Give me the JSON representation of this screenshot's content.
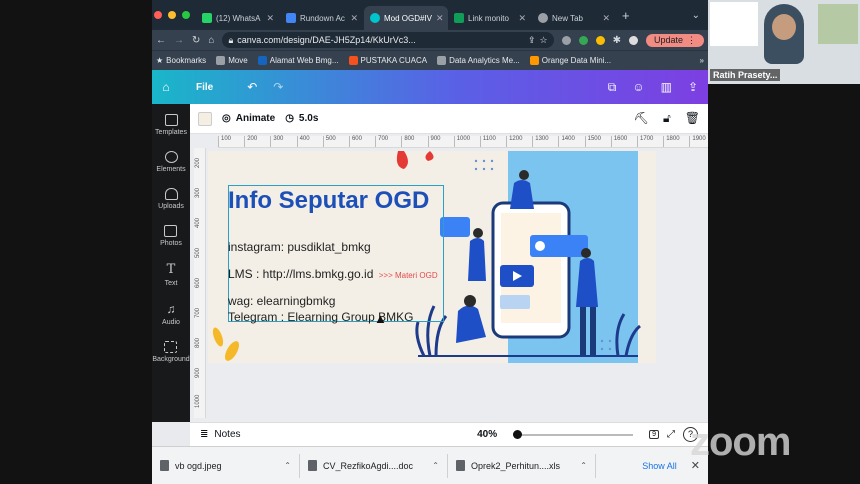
{
  "browser": {
    "tabs": [
      {
        "label": "(12) WhatsA",
        "color": "#25d366"
      },
      {
        "label": "Rundown Ac",
        "color": "#4285f4"
      },
      {
        "label": "Mod OGD#IV",
        "color": "#00c4cc",
        "active": true
      },
      {
        "label": "Link monito",
        "color": "#0f9d58"
      },
      {
        "label": "New Tab",
        "color": "#9aa0a6"
      }
    ],
    "url": "canva.com/design/DAE-JH5Zp14/KkUrVc3...",
    "update_label": "Update",
    "bookmarks": [
      "Bookmarks",
      "Move",
      "Alamat Web Bmg...",
      "PUSTAKA CUACA",
      "Data Analytics Me...",
      "Orange Data Mini..."
    ]
  },
  "canva": {
    "file_label": "File",
    "animate_label": "Animate",
    "duration": "5.0s",
    "side_items": [
      "Templates",
      "Elements",
      "Uploads",
      "Photos",
      "Text",
      "Audio",
      "Background"
    ],
    "ruler_marks": [
      "100",
      "200",
      "300",
      "400",
      "500",
      "600",
      "700",
      "800",
      "900",
      "1000",
      "1100",
      "1200",
      "1300",
      "1400",
      "1500",
      "1600",
      "1700",
      "1800",
      "1900"
    ],
    "vruler_marks": [
      "200",
      "300",
      "400",
      "500",
      "600",
      "700",
      "800",
      "900",
      "1000"
    ],
    "slide": {
      "title": "Info Seputar OGD",
      "instagram": "instagram: pusdiklat_bmkg",
      "lms": "LMS : http://lms.bmkg.go.id",
      "materi": ">>> Materi OGD",
      "wag": "wag: elearningbmkg",
      "telegram": "Telegram : Elearning Group BMKG"
    },
    "notes_label": "Notes",
    "zoom_level": "40%",
    "page_count": "9"
  },
  "downloads": {
    "items": [
      "vb ogd.jpeg",
      "CV_RezfikoAgdi....doc",
      "Oprek2_Perhitun....xls"
    ],
    "show_all": "Show All"
  },
  "participant": {
    "name": "Ratih Prasety..."
  },
  "zoom_brand": "zoom"
}
